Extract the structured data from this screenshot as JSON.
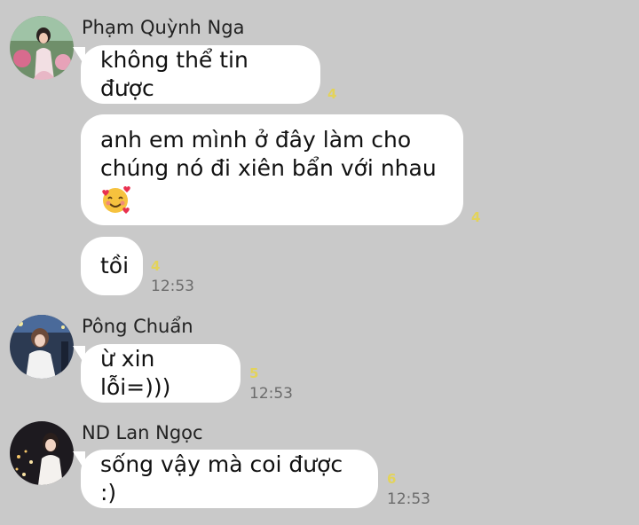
{
  "messages": [
    {
      "sender": "Phạm Quỳnh Nga",
      "bubbles": [
        {
          "text": "không thể tin được",
          "reaction": "4"
        },
        {
          "line1": "anh em mình ở đây làm cho",
          "line2": "chúng nó đi xiên bẩn với nhau",
          "emoji": "smiling-face-with-hearts-emoji",
          "reaction": "4"
        },
        {
          "text": "tồi",
          "reaction": "4",
          "time": "12:53"
        }
      ]
    },
    {
      "sender": "Pông Chuẩn",
      "bubbles": [
        {
          "text": "ừ xin lỗi=)))",
          "reaction": "5",
          "time": "12:53"
        }
      ]
    },
    {
      "sender": "ND Lan Ngọc",
      "bubbles": [
        {
          "text": "sống vậy mà coi được :)",
          "reaction": "6",
          "time": "12:53"
        }
      ]
    }
  ],
  "colors": {
    "background": "#c9c9c9",
    "bubble": "#ffffff",
    "reaction": "#e3d35a",
    "timestamp": "#6b6b6b"
  }
}
